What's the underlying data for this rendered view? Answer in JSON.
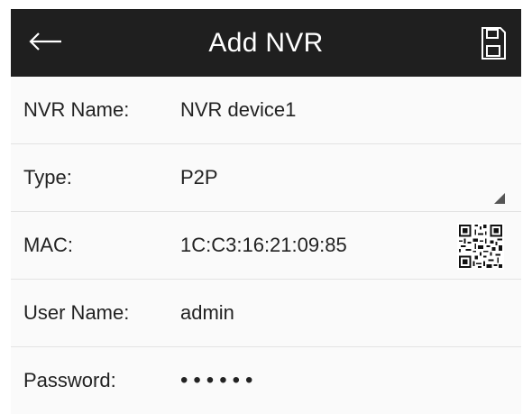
{
  "header": {
    "title": "Add NVR",
    "back_icon": "arrow-left-icon",
    "save_icon": "save-icon"
  },
  "form": {
    "nvr_name": {
      "label": "NVR Name:",
      "value": "NVR device1"
    },
    "type": {
      "label": "Type:",
      "value": "P2P"
    },
    "mac": {
      "label": "MAC:",
      "value": "1C:C3:16:21:09:85",
      "qr_icon": "qr-code-icon"
    },
    "user_name": {
      "label": "User Name:",
      "value": "admin"
    },
    "password": {
      "label": "Password:",
      "value": "••••••"
    }
  },
  "colors": {
    "header_bg": "#1f1f1f",
    "header_text": "#ffffff",
    "row_bg": "#fafafa",
    "divider": "#e3e3e3"
  }
}
